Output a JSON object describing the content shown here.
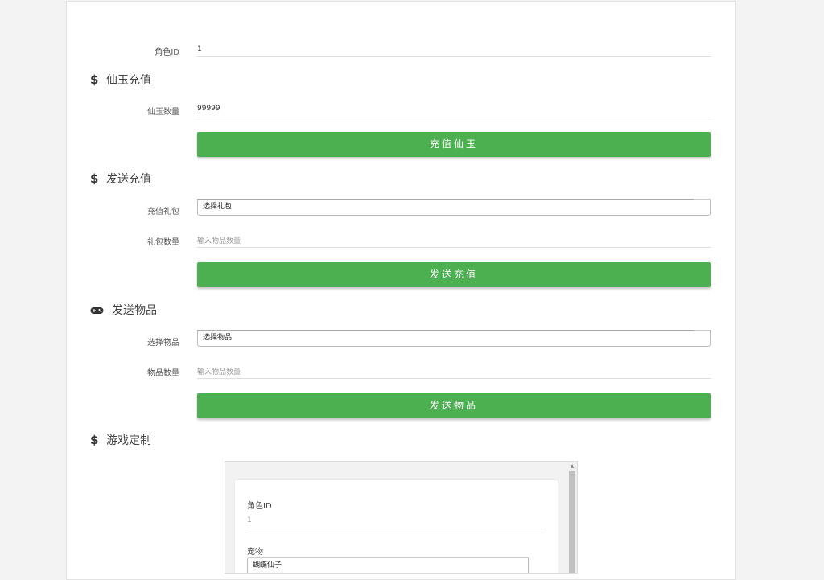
{
  "role": {
    "label": "角色ID",
    "value": "1"
  },
  "jade": {
    "title": "仙玉充值",
    "icon": "dollar-icon",
    "amount_label": "仙玉数量",
    "amount_value": "99999",
    "button": "充值仙玉"
  },
  "recharge": {
    "title": "发送充值",
    "icon": "dollar-icon",
    "gift_label": "充值礼包",
    "gift_select": "选择礼包",
    "count_label": "礼包数量",
    "count_placeholder": "输入物品数量",
    "button": "发送充值"
  },
  "items": {
    "title": "发送物品",
    "icon": "gamepad-icon",
    "select_label": "选择物品",
    "select_value": "选择物品",
    "count_label": "物品数量",
    "count_placeholder": "输入物品数量",
    "button": "发送物品"
  },
  "custom": {
    "title": "游戏定制",
    "icon": "dollar-icon",
    "frame": {
      "role_label": "角色ID",
      "role_placeholder": "1",
      "pet_label": "宠物",
      "pet_value": "蝴蝶仙子"
    }
  }
}
